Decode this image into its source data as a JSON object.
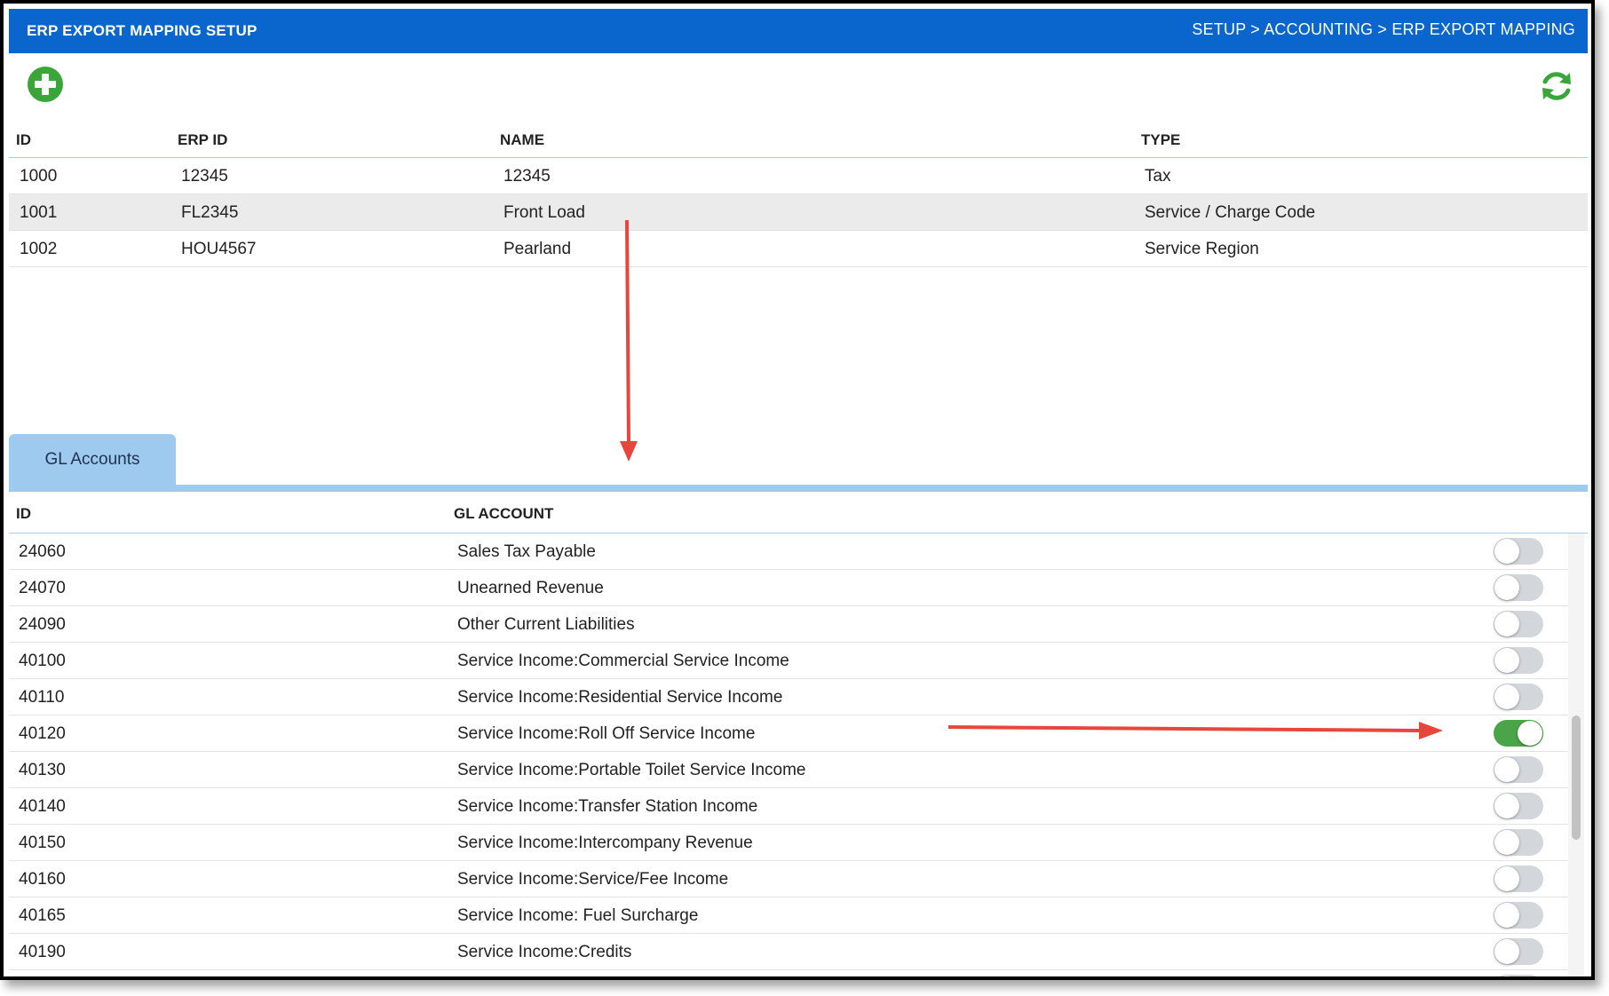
{
  "header": {
    "title": "ERP EXPORT MAPPING SETUP",
    "breadcrumb": "SETUP > ACCOUNTING > ERP EXPORT MAPPING"
  },
  "toolbar": {
    "add_icon": "plus-circle-icon",
    "refresh_icon": "refresh-icon",
    "accent": "#3aa63a"
  },
  "mapping_grid": {
    "columns": [
      "ID",
      "ERP ID",
      "NAME",
      "TYPE"
    ],
    "rows": [
      {
        "id": "1000",
        "erp_id": "12345",
        "name": "12345",
        "type": "Tax"
      },
      {
        "id": "1001",
        "erp_id": "FL2345",
        "name": "Front Load",
        "type": "Service / Charge Code"
      },
      {
        "id": "1002",
        "erp_id": "HOU4567",
        "name": "Pearland",
        "type": "Service Region"
      }
    ],
    "selected_index": 1
  },
  "tabs": [
    {
      "label": "GL Accounts",
      "active": true
    }
  ],
  "gl_grid": {
    "columns": [
      "ID",
      "GL ACCOUNT"
    ],
    "rows": [
      {
        "id": "24060",
        "account": "Sales Tax Payable",
        "enabled": false
      },
      {
        "id": "24070",
        "account": "Unearned Revenue",
        "enabled": false
      },
      {
        "id": "24090",
        "account": "Other Current Liabilities",
        "enabled": false
      },
      {
        "id": "40100",
        "account": "Service Income:Commercial Service Income",
        "enabled": false
      },
      {
        "id": "40110",
        "account": "Service Income:Residential Service Income",
        "enabled": false
      },
      {
        "id": "40120",
        "account": "Service Income:Roll Off Service Income",
        "enabled": true
      },
      {
        "id": "40130",
        "account": "Service Income:Portable Toilet Service Income",
        "enabled": false
      },
      {
        "id": "40140",
        "account": "Service Income:Transfer Station Income",
        "enabled": false
      },
      {
        "id": "40150",
        "account": "Service Income:Intercompany Revenue",
        "enabled": false
      },
      {
        "id": "40160",
        "account": "Service Income:Service/Fee Income",
        "enabled": false
      },
      {
        "id": "40165",
        "account": "Service Income: Fuel Surcharge",
        "enabled": false
      },
      {
        "id": "40190",
        "account": "Service Income:Credits",
        "enabled": false
      }
    ]
  },
  "colors": {
    "header_bg": "#0a66cc",
    "tab_bg": "#9fcaf0",
    "toggle_on": "#4aa548",
    "annotation_arrow": "#e8463c"
  }
}
